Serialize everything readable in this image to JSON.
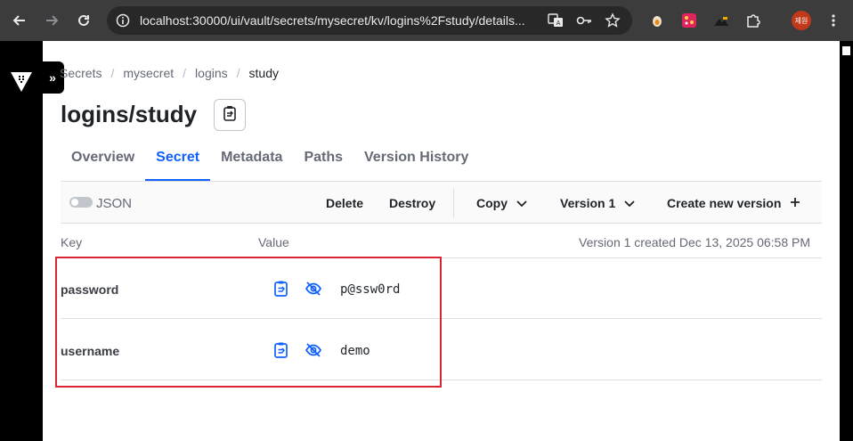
{
  "browser": {
    "url": "localhost:30000/ui/vault/secrets/mysecret/kv/logins%2Fstudy/details...",
    "profile_label": "제원"
  },
  "breadcrumb": [
    {
      "label": "Secrets"
    },
    {
      "label": "mysecret"
    },
    {
      "label": "logins"
    },
    {
      "label": "study"
    }
  ],
  "page": {
    "title": "logins/study"
  },
  "tabs": [
    {
      "label": "Overview",
      "active": false
    },
    {
      "label": "Secret",
      "active": true
    },
    {
      "label": "Metadata",
      "active": false
    },
    {
      "label": "Paths",
      "active": false
    },
    {
      "label": "Version History",
      "active": false
    }
  ],
  "toolbar": {
    "json_toggle_label": "JSON",
    "delete_label": "Delete",
    "destroy_label": "Destroy",
    "copy_label": "Copy",
    "version_label": "Version 1",
    "create_label": "Create new version"
  },
  "table": {
    "header_key": "Key",
    "header_value": "Value",
    "version_created": "Version 1 created Dec 13, 2025 06:58 PM",
    "rows": [
      {
        "key": "password",
        "value": "p@ssw0rd"
      },
      {
        "key": "username",
        "value": "demo"
      }
    ]
  },
  "colors": {
    "accent": "#1060ff",
    "highlight_box": "#d92632"
  }
}
